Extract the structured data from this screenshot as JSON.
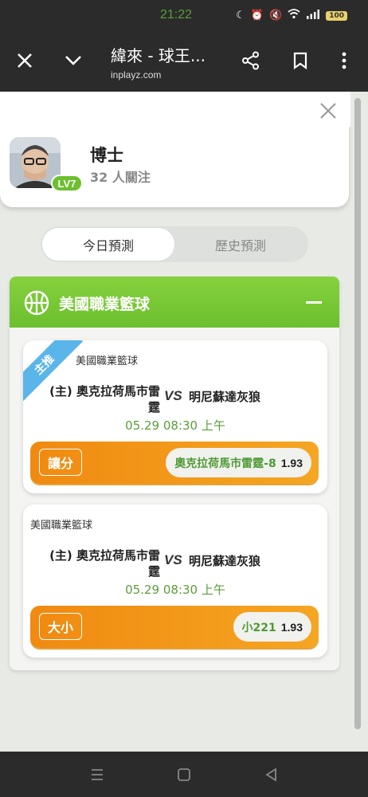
{
  "status": {
    "time": "21:22",
    "battery": "100"
  },
  "browser": {
    "title": "緯來 - 球王...",
    "url": "inplayz.com"
  },
  "profile": {
    "name": "博士",
    "followers": "32 人關注",
    "level": "LV7"
  },
  "tabs": [
    {
      "label": "今日預測",
      "active": true
    },
    {
      "label": "歷史預測",
      "active": false
    }
  ],
  "league": {
    "title": "美國職業籃球",
    "matches": [
      {
        "featured_label": "主推",
        "league": "美國職業籃球",
        "home_line1": "(主) 奧克拉荷馬市雷",
        "home_line2": "霆",
        "vs": "VS",
        "away": "明尼蘇達灰狼",
        "time": "05.29 08:30 上午",
        "bet_type": "讓分",
        "pick": "奧克拉荷馬市雷霆-8",
        "odds": "1.93"
      },
      {
        "league": "美國職業籃球",
        "home_line1": "(主) 奧克拉荷馬市雷",
        "home_line2": "霆",
        "vs": "VS",
        "away": "明尼蘇達灰狼",
        "time": "05.29 08:30 上午",
        "bet_type": "大小",
        "pick": "小221",
        "odds": "1.93"
      }
    ]
  },
  "colors": {
    "accent_green": "#6cbf2e",
    "accent_orange": "#f08a10",
    "ribbon_blue": "#5ab5ea"
  }
}
